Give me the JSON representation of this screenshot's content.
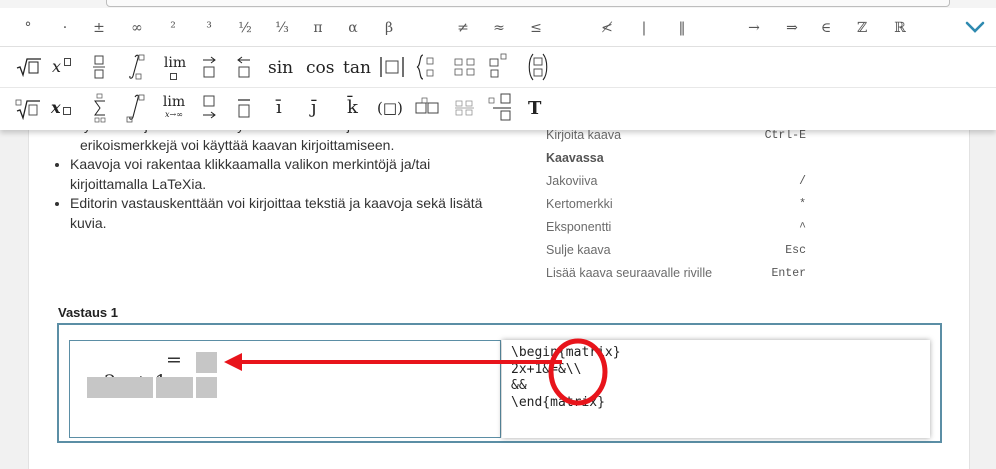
{
  "toolbar": {
    "row1": [
      "°",
      "·",
      "±",
      "∞",
      "²",
      "³",
      "½",
      "⅓",
      "π",
      "α",
      "β",
      "≠",
      "≈",
      "≤",
      "≮",
      "|",
      "‖",
      "→",
      "⇒",
      "∈",
      "ℤ",
      "ℝ"
    ],
    "row2": {
      "sin": "sin",
      "cos": "cos",
      "tan": "tan",
      "lim": "lim"
    },
    "row3": {
      "lim": "lim",
      "lim_sub": "x→∞",
      "i": "ī",
      "j": "j̄",
      "k": "k̄",
      "paren": "(□)",
      "text": "T"
    }
  },
  "instructions": {
    "line_partial": "fysiikassa ja kemiassa käytettäviä merkintöjä. Lisäksi",
    "line_partial2": "erikoismerkkejä voi käyttää kaavan kirjoittamiseen.",
    "bullet2_a": "Kaavoja voi rakentaa klikkaamalla valikon merkintöjä ja/tai",
    "bullet2_b": "kirjoittamalla LaTeXia.",
    "bullet3_a": "Editorin vastauskenttään voi kirjoittaa tekstiä ja kaavoja sekä lisätä",
    "bullet3_b": "kuvia."
  },
  "shortcuts": {
    "first": {
      "label": "Kirjoita kaava",
      "key": "Ctrl-E"
    },
    "heading": "Kaavassa",
    "items": [
      {
        "label": "Jakoviiva",
        "key": "/"
      },
      {
        "label": "Kertomerkki",
        "key": "*"
      },
      {
        "label": "Eksponentti",
        "key": "^"
      },
      {
        "label": "Sulje kaava",
        "key": "Esc"
      },
      {
        "label": "Lisää kaava seuraavalle riville",
        "key": "Enter"
      }
    ]
  },
  "answer": {
    "label": "Vastaus 1",
    "math_lhs": "2x + 1",
    "math_eq": "=",
    "latex_lines": [
      "\\begin{matrix}",
      "2x+1&=&\\\\",
      "&&",
      "\\end{matrix}"
    ]
  },
  "colors": {
    "annotation": "#e8141b",
    "frame": "#5b8ea5",
    "chevron": "#2f8ab0"
  }
}
